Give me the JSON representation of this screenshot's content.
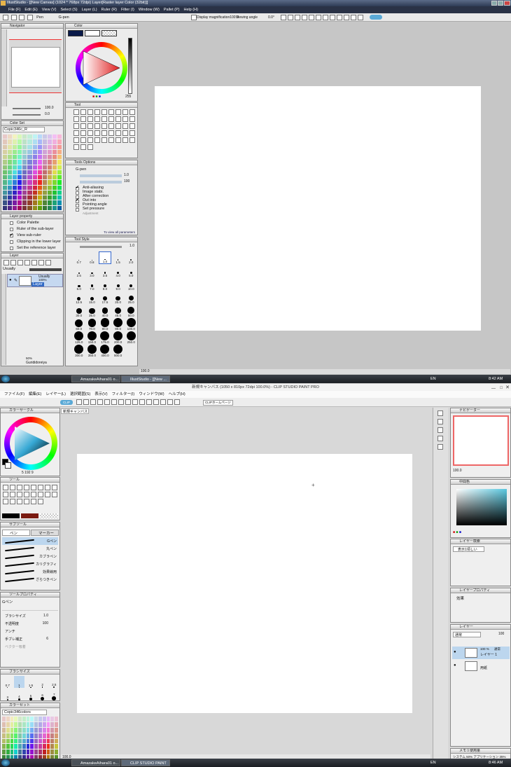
{
  "top": {
    "title": "IllustStudio - [[New Canvas] (1024 * 768px 72dpi)   Layer[Raster layer Color (32bit)]]",
    "menu": [
      "File (F)",
      "Edit (E)",
      "View (V)",
      "Select (S)",
      "Layer (L)",
      "Ruler (R)",
      "Filter (I)",
      "Window (W)",
      "Pallet (P)",
      "Help (H)"
    ],
    "tool_name": "Pen",
    "tool_sub": "G-pen",
    "display_mag": "Display magnification100.0",
    "view_angle_label": "Viewing angle",
    "view_angle": "0.0°",
    "panels": {
      "navigator": "Navigator",
      "color": "Color",
      "tool": "Tool",
      "color_set": "Color Set",
      "tool_options": "Tools Options",
      "layer_property": "Layer property",
      "layer": "Layer",
      "tool_style": "Tool Style"
    },
    "nav_zoom": "100.0",
    "nav_rot": "0.0",
    "color_value": "255",
    "colorset_name": "Copic346c_R",
    "tool_options": {
      "tool": "G-pen",
      "size": "1.0",
      "opacity": "100",
      "items": [
        {
          "label": "Anti-aliasing",
          "checked": true
        },
        {
          "label": "Image stabi.",
          "checked": false
        },
        {
          "label": "After correction",
          "checked": false
        },
        {
          "label": "Out into",
          "checked": true
        },
        {
          "label": "Pointing angle",
          "checked": false
        },
        {
          "label": "Set pressure",
          "checked": false
        }
      ],
      "adjustment": "Adjustment",
      "footer": "To view all parameters"
    },
    "layer_property": [
      "Color Palette",
      "Ruler of the sub-layer",
      "View sub-ruler",
      "Clipping in the lower layer",
      "Set the reference layer"
    ],
    "layer": {
      "mode": "Usually",
      "opacity": "100%",
      "name": "Layer",
      "bottom_pct": "50%",
      "bottom_name": "Gurididoreiya"
    },
    "tool_style": {
      "size": "1.0",
      "sizes": [
        "0.7",
        "0.8",
        "1.0",
        "1.5",
        "2.0",
        "2.5",
        "3.0",
        "3.5",
        "4.0",
        "5.0",
        "6.0",
        "7.0",
        "8.0",
        "9.0",
        "10.0",
        "12.5",
        "15.0",
        "17.5",
        "20.0",
        "25.0",
        "30.0",
        "35.0",
        "40.0",
        "45.0",
        "50.0",
        "60.0",
        "70.0",
        "80.0",
        "90.0",
        "100.0",
        "125.0",
        "150.0",
        "175.0",
        "200.0",
        "250.0",
        "300.0",
        "350.0",
        "400.0",
        "500.0"
      ]
    },
    "status_zoom": "100.0",
    "taskbar": {
      "b1": "AmazakeAihara01 o...",
      "b2": "IllustStudio - [[New ...",
      "lang": "EN",
      "time": "8:42 AM"
    }
  },
  "bot": {
    "title": "新規キャンバス (1050 x 810px 72dpi 100.0%)  - CLIP STUDIO PAINT PRO",
    "menu": [
      "ファイル(F)",
      "編集(E)",
      "レイヤー(L)",
      "選択範囲(S)",
      "表示(V)",
      "フィルター(I)",
      "ウィンドウ(W)",
      "ヘルプ(H)"
    ],
    "cmd_badge": "CLIP",
    "home_label": "CLIPホームページ",
    "tab": "新規キャンバス",
    "panels": {
      "color_circle": "カラーサークル",
      "tool": "ツール",
      "subtool": "サブツール",
      "toolprop": "ツールプロパティ",
      "brushsize": "ブラシサイズ",
      "colorset": "カラーセット",
      "navigator": "ナビゲーター",
      "mid_color": "中間色",
      "layer_search": "レイヤー検索",
      "layer_prop": "レイヤープロパティ",
      "layer": "レイヤー",
      "memory": "メモリ使用量"
    },
    "color_hsv": "5 192 9",
    "subtool_tabs": [
      "ペン",
      "マーカー"
    ],
    "pens": [
      "Gペン",
      "丸ペン",
      "カブラペン",
      "カリグラフィ",
      "効果線用",
      "ざらつきペン"
    ],
    "toolprop": {
      "name": "Gペン",
      "rows": [
        {
          "label": "ブラシサイズ",
          "value": "1.0"
        },
        {
          "label": "不透明度",
          "value": "100"
        },
        {
          "label": "アンチ",
          "value": ""
        },
        {
          "label": "手ブレ補正",
          "value": "6"
        },
        {
          "label": "ベクター吸着",
          "value": ""
        }
      ]
    },
    "brush_sizes": [
      "0.7",
      "1",
      "1.5",
      "2",
      "2.5",
      "3",
      "4",
      "5",
      "6",
      "7"
    ],
    "colorset_name": "Copic346colors",
    "nav_zoom": "100.0",
    "layer_search_label": "表示1項しい",
    "effect_label": "効果",
    "layer": {
      "mode": "通常",
      "opacity": "100",
      "l1_pct": "100 %",
      "l1_mode": "通常",
      "l1_name": "レイヤー 1",
      "l2_name": "用紙"
    },
    "memory": "システム 50%  アプリケーション 35%",
    "status_zoom": "100.0",
    "taskbar": {
      "b1": "AmazakeAihara01 o...",
      "b2": "CLIP STUDIO PAINT",
      "lang": "EN",
      "time": "8:46 AM"
    }
  },
  "colors": {
    "selection": "#316ac5",
    "canvas": "#ffffff",
    "desktop_gray": "#c6c6c6",
    "csp_blue": "#5aa9d6"
  }
}
